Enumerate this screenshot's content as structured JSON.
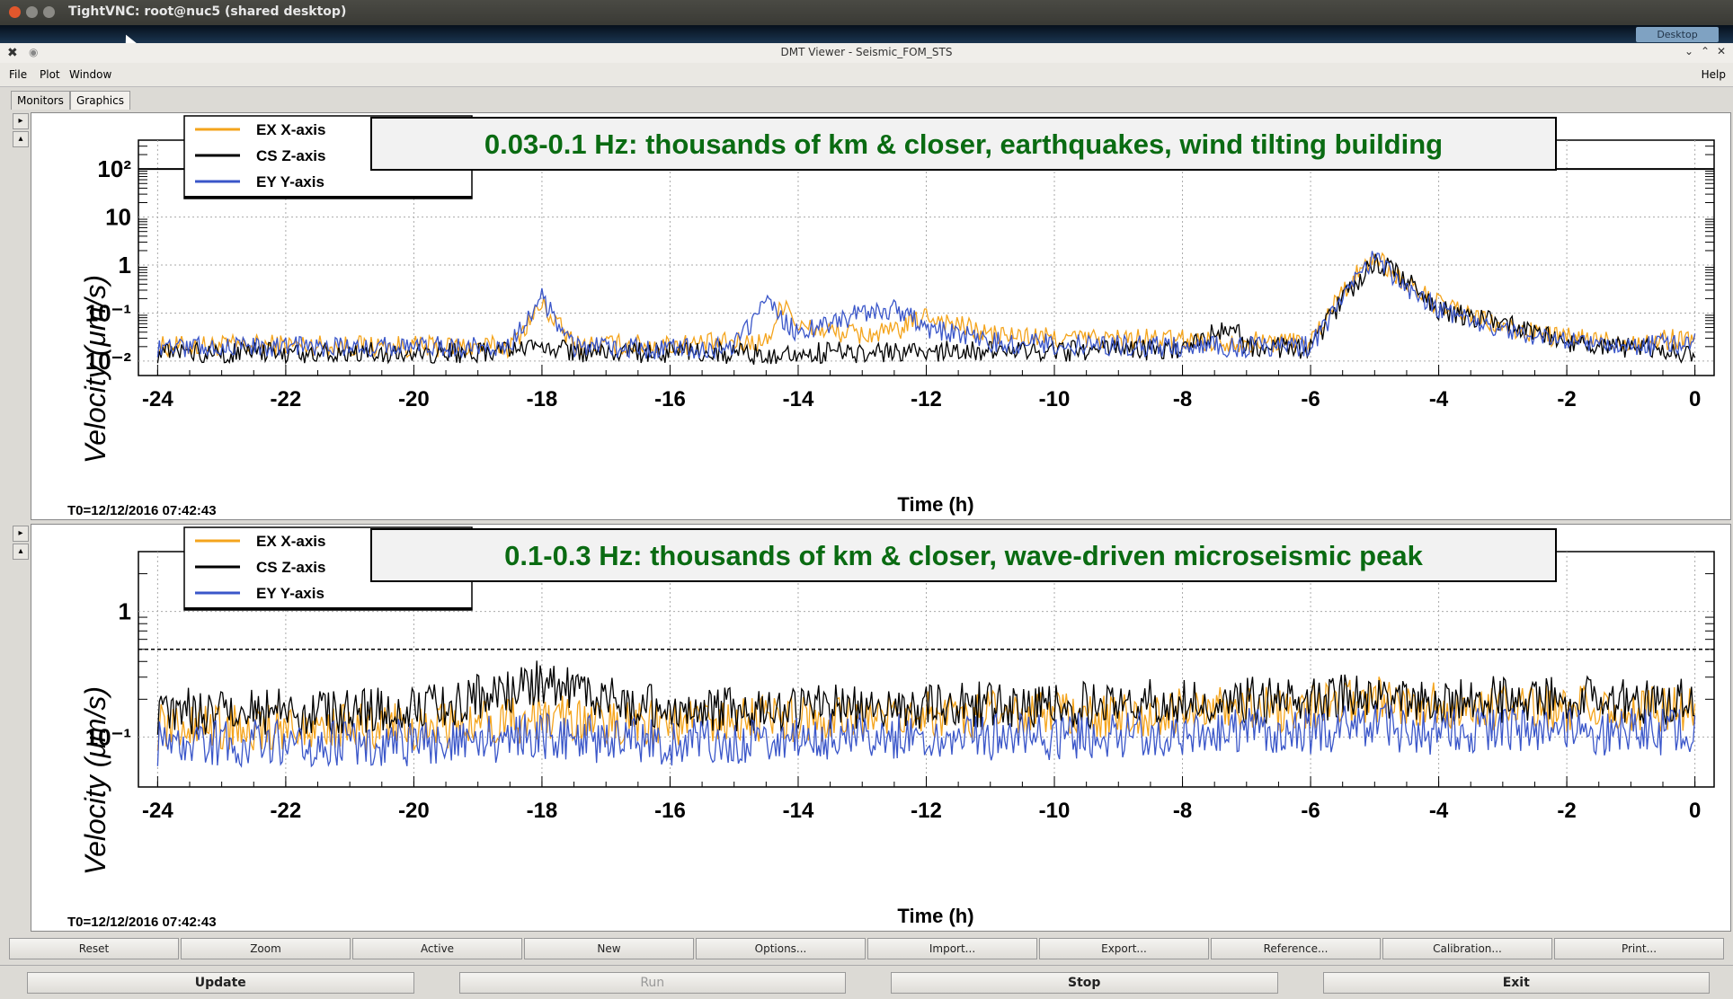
{
  "vnc": {
    "title": "TightVNC: root@nuc5 (shared desktop)",
    "desktop_chip": "Desktop"
  },
  "window": {
    "title": "DMT Viewer - Seismic_FOM_STS"
  },
  "menu": {
    "file": "File",
    "plot": "Plot",
    "window": "Window",
    "help": "Help"
  },
  "tabs": [
    "Monitors",
    "Graphics"
  ],
  "colors": {
    "ex": "#f4a41c",
    "cs": "#000000",
    "ey": "#3a56c9",
    "annotation": "#0a6b12"
  },
  "charts": [
    {
      "banner": "0.03-0.1 Hz: thousands of km & closer, earthquakes, wind tilting building",
      "legend": [
        "EX X-axis",
        "CS Z-axis",
        "EY Y-axis"
      ],
      "ylabel": "Velocity  (μm/s)",
      "xlabel": "Time (h)",
      "t0": "T0=12/12/2016 07:42:43",
      "xticks": [
        "-24",
        "-22",
        "-20",
        "-18",
        "-16",
        "-14",
        "-12",
        "-10",
        "-8",
        "-6",
        "-4",
        "-2",
        "0"
      ],
      "yticks": [
        "10²",
        "10",
        "1",
        "10⁻¹",
        "10⁻²"
      ]
    },
    {
      "banner": "0.1-0.3 Hz: thousands of km & closer, wave-driven microseismic peak",
      "legend": [
        "EX X-axis",
        "CS Z-axis",
        "EY Y-axis"
      ],
      "ylabel": "Velocity  (μm/s)",
      "xlabel": "Time (h)",
      "t0": "T0=12/12/2016 07:42:43",
      "xticks": [
        "-24",
        "-22",
        "-20",
        "-18",
        "-16",
        "-14",
        "-12",
        "-10",
        "-8",
        "-6",
        "-4",
        "-2",
        "0"
      ],
      "yticks": [
        "1",
        "10⁻¹"
      ]
    }
  ],
  "chart_data": [
    {
      "type": "line",
      "x_range": [
        -24.3,
        0.3
      ],
      "ylim": [
        0.005,
        400
      ],
      "log_y": true,
      "reference_line": 100,
      "series": [
        {
          "name": "EX X-axis",
          "x": [
            -24,
            -22,
            -20,
            -18.5,
            -18,
            -17.5,
            -16,
            -14.5,
            -14.2,
            -14,
            -13,
            -12.5,
            -12,
            -11,
            -10,
            -8,
            -7,
            -6,
            -5.5,
            -5,
            -4.5,
            -4,
            -3,
            -2,
            -1,
            0
          ],
          "y": [
            0.02,
            0.022,
            0.02,
            0.02,
            0.15,
            0.022,
            0.022,
            0.025,
            0.2,
            0.05,
            0.035,
            0.04,
            0.09,
            0.035,
            0.03,
            0.028,
            0.025,
            0.025,
            0.3,
            1.5,
            0.4,
            0.15,
            0.05,
            0.03,
            0.025,
            0.03
          ]
        },
        {
          "name": "CS Z-axis",
          "x": [
            -24,
            -22,
            -20,
            -18.5,
            -18,
            -17.5,
            -16,
            -14.5,
            -14,
            -13,
            -12,
            -11,
            -10,
            -8,
            -7.2,
            -7,
            -6,
            -5.5,
            -5,
            -4.5,
            -4,
            -3,
            -2,
            -1,
            0
          ],
          "y": [
            0.015,
            0.015,
            0.015,
            0.015,
            0.02,
            0.015,
            0.015,
            0.014,
            0.015,
            0.015,
            0.016,
            0.016,
            0.016,
            0.017,
            0.06,
            0.02,
            0.018,
            0.2,
            1.2,
            0.5,
            0.12,
            0.06,
            0.025,
            0.018,
            0.015
          ]
        },
        {
          "name": "EY Y-axis",
          "x": [
            -24,
            -22,
            -20,
            -18.5,
            -18,
            -17.5,
            -16,
            -15,
            -14.5,
            -14,
            -13,
            -12.5,
            -12,
            -11,
            -10,
            -8,
            -6,
            -5.5,
            -5,
            -4.5,
            -4,
            -3,
            -2,
            -1,
            0
          ],
          "y": [
            0.02,
            0.02,
            0.02,
            0.02,
            0.2,
            0.02,
            0.018,
            0.02,
            0.15,
            0.04,
            0.1,
            0.12,
            0.05,
            0.025,
            0.022,
            0.02,
            0.02,
            0.2,
            1.4,
            0.3,
            0.12,
            0.04,
            0.025,
            0.02,
            0.025
          ]
        }
      ]
    },
    {
      "type": "line",
      "x_range": [
        -24.3,
        0.3
      ],
      "ylim": [
        0.04,
        3
      ],
      "log_y": true,
      "reference_line": 0.5,
      "series": [
        {
          "name": "EX X-axis",
          "x": [
            -24,
            -20,
            -18,
            -16,
            -14,
            -12,
            -10,
            -8,
            -6,
            -5,
            -4,
            -2,
            0
          ],
          "y": [
            0.12,
            0.12,
            0.14,
            0.13,
            0.14,
            0.15,
            0.15,
            0.16,
            0.17,
            0.2,
            0.18,
            0.17,
            0.17
          ]
        },
        {
          "name": "CS Z-axis",
          "x": [
            -24,
            -20,
            -18,
            -16,
            -14,
            -12,
            -10,
            -8,
            -6,
            -5,
            -4,
            -2,
            0
          ],
          "y": [
            0.16,
            0.16,
            0.28,
            0.16,
            0.17,
            0.18,
            0.18,
            0.19,
            0.2,
            0.22,
            0.2,
            0.2,
            0.19
          ]
        },
        {
          "name": "EY Y-axis",
          "x": [
            -24,
            -20,
            -18,
            -16,
            -14,
            -12,
            -10,
            -8,
            -6,
            -5,
            -4,
            -2,
            0
          ],
          "y": [
            0.09,
            0.09,
            0.1,
            0.09,
            0.1,
            0.1,
            0.1,
            0.11,
            0.11,
            0.12,
            0.11,
            0.11,
            0.11
          ]
        }
      ]
    }
  ],
  "buttons_row1": [
    "Reset",
    "Zoom",
    "Active",
    "New",
    "Options...",
    "Import...",
    "Export...",
    "Reference...",
    "Calibration...",
    "Print..."
  ],
  "buttons_row2": [
    "Update",
    "Run",
    "Stop",
    "Exit"
  ]
}
